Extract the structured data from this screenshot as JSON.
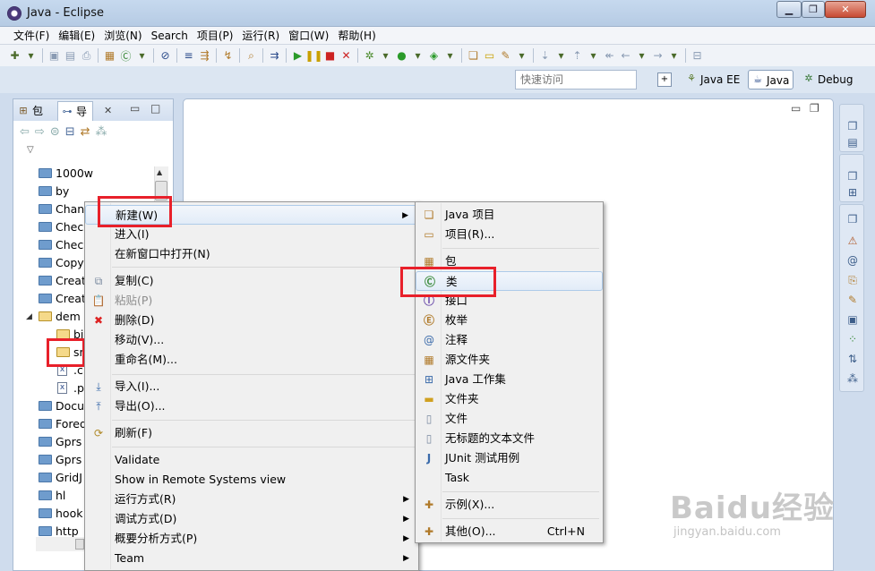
{
  "window": {
    "title": "Java - Eclipse",
    "controls": {
      "minimize": "▁",
      "maximize": "❐",
      "close": "✕"
    }
  },
  "menubar": [
    "文件(F)",
    "编辑(E)",
    "浏览(N)",
    "Search",
    "项目(P)",
    "运行(R)",
    "窗口(W)",
    "帮助(H)"
  ],
  "quick_access": {
    "placeholder": "快速访问"
  },
  "perspectives": [
    {
      "label": "Java EE",
      "icon": "java-ee-icon",
      "active": false
    },
    {
      "label": "Java",
      "icon": "java-perspective-icon",
      "active": true
    },
    {
      "label": "Debug",
      "icon": "debug-icon",
      "active": false
    }
  ],
  "left_view": {
    "tabs": [
      {
        "label": "包",
        "icon": "package-explorer-icon"
      },
      {
        "label": "导",
        "icon": "navigator-icon"
      }
    ],
    "tree": [
      {
        "label": "1000w",
        "type": "folder"
      },
      {
        "label": "by",
        "type": "folder"
      },
      {
        "label": "Chan",
        "type": "folder"
      },
      {
        "label": "Check",
        "type": "folder"
      },
      {
        "label": "Check",
        "type": "folder"
      },
      {
        "label": "Copy",
        "type": "folder"
      },
      {
        "label": "Creat",
        "type": "folder"
      },
      {
        "label": "Creat",
        "type": "folder"
      },
      {
        "label": "dem",
        "type": "folder-open"
      },
      {
        "label": "bi",
        "type": "folder-open"
      },
      {
        "label": "sr",
        "type": "folder-open"
      },
      {
        "label": ".c",
        "type": "file"
      },
      {
        "label": ".p",
        "type": "file"
      },
      {
        "label": "Docu",
        "type": "folder"
      },
      {
        "label": "Fored",
        "type": "folder"
      },
      {
        "label": "Gprs",
        "type": "folder"
      },
      {
        "label": "Gprs",
        "type": "folder"
      },
      {
        "label": "GridJ",
        "type": "folder"
      },
      {
        "label": "hl",
        "type": "folder"
      },
      {
        "label": "hook",
        "type": "folder"
      },
      {
        "label": "http",
        "type": "folder"
      }
    ]
  },
  "context_menu": [
    {
      "label": "新建(W)",
      "icon": "",
      "submenu": true
    },
    {
      "label": "进入(I)",
      "icon": ""
    },
    {
      "label": "在新窗口中打开(N)",
      "icon": ""
    },
    {
      "label": "复制(C)",
      "icon": "copy-icon"
    },
    {
      "label": "粘贴(P)",
      "icon": "paste-icon",
      "disabled": true
    },
    {
      "label": "删除(D)",
      "icon": "delete-icon"
    },
    {
      "label": "移动(V)...",
      "icon": ""
    },
    {
      "label": "重命名(M)...",
      "icon": ""
    },
    {
      "label": "导入(I)...",
      "icon": "import-icon"
    },
    {
      "label": "导出(O)...",
      "icon": "export-icon"
    },
    {
      "label": "刷新(F)",
      "icon": "refresh-icon"
    },
    {
      "label": "Validate",
      "icon": ""
    },
    {
      "label": "Show in Remote Systems view",
      "icon": ""
    },
    {
      "label": "运行方式(R)",
      "icon": "",
      "submenu": true
    },
    {
      "label": "调试方式(D)",
      "icon": "",
      "submenu": true
    },
    {
      "label": "概要分析方式(P)",
      "icon": "",
      "submenu": true
    },
    {
      "label": "Team",
      "icon": "",
      "submenu": true
    }
  ],
  "submenu": [
    {
      "label": "Java 项目",
      "icon": "java-project-icon"
    },
    {
      "label": "项目(R)...",
      "icon": "project-icon"
    },
    {
      "label": "包",
      "icon": "package-icon"
    },
    {
      "label": "类",
      "icon": "class-icon",
      "highlighted": true
    },
    {
      "label": "接口",
      "icon": "interface-icon"
    },
    {
      "label": "枚举",
      "icon": "enum-icon"
    },
    {
      "label": "注释",
      "icon": "annotation-icon"
    },
    {
      "label": "源文件夹",
      "icon": "source-folder-icon"
    },
    {
      "label": "Java 工作集",
      "icon": "working-set-icon"
    },
    {
      "label": "文件夹",
      "icon": "folder-icon"
    },
    {
      "label": "文件",
      "icon": "file-icon"
    },
    {
      "label": "无标题的文本文件",
      "icon": "untitled-text-file-icon"
    },
    {
      "label": "JUnit 测试用例",
      "icon": "junit-icon"
    },
    {
      "label": "Task",
      "icon": "task-icon"
    },
    {
      "label": "示例(X)...",
      "icon": "example-icon"
    },
    {
      "label": "其他(O)...",
      "icon": "other-wizard-icon",
      "shortcut": "Ctrl+N"
    }
  ],
  "watermark": {
    "logo": "Baidu经验",
    "url": "jingyan.baidu.com"
  },
  "colors": {
    "highlight_box": "#e8202a",
    "menu_bg": "#f0f0f0",
    "titlebar": "#b6cbe4"
  }
}
